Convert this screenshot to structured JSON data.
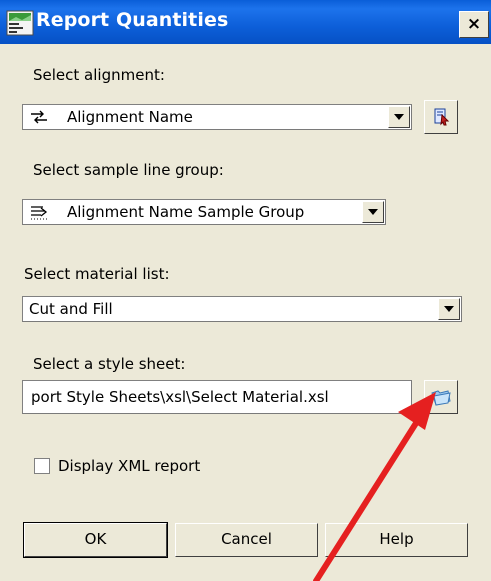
{
  "window": {
    "title": "Report Quantities",
    "close_label": "×"
  },
  "alignment": {
    "label": "Select alignment:",
    "value": "Alignment Name"
  },
  "sample_line_group": {
    "label": "Select sample line group:",
    "value": "Alignment Name Sample Group"
  },
  "material_list": {
    "label": "Select material list:",
    "value": "Cut and Fill"
  },
  "style_sheet": {
    "label": "Select a style sheet:",
    "value": "port Style Sheets\\xsl\\Select Material.xsl"
  },
  "display_xml": {
    "label": "Display XML report",
    "checked": false
  },
  "buttons": {
    "ok": "OK",
    "cancel": "Cancel",
    "help": "Help"
  },
  "colors": {
    "titlebar": "#0a5ed8",
    "dialog_bg": "#ece9d8",
    "annotation_arrow": "#e52020"
  }
}
